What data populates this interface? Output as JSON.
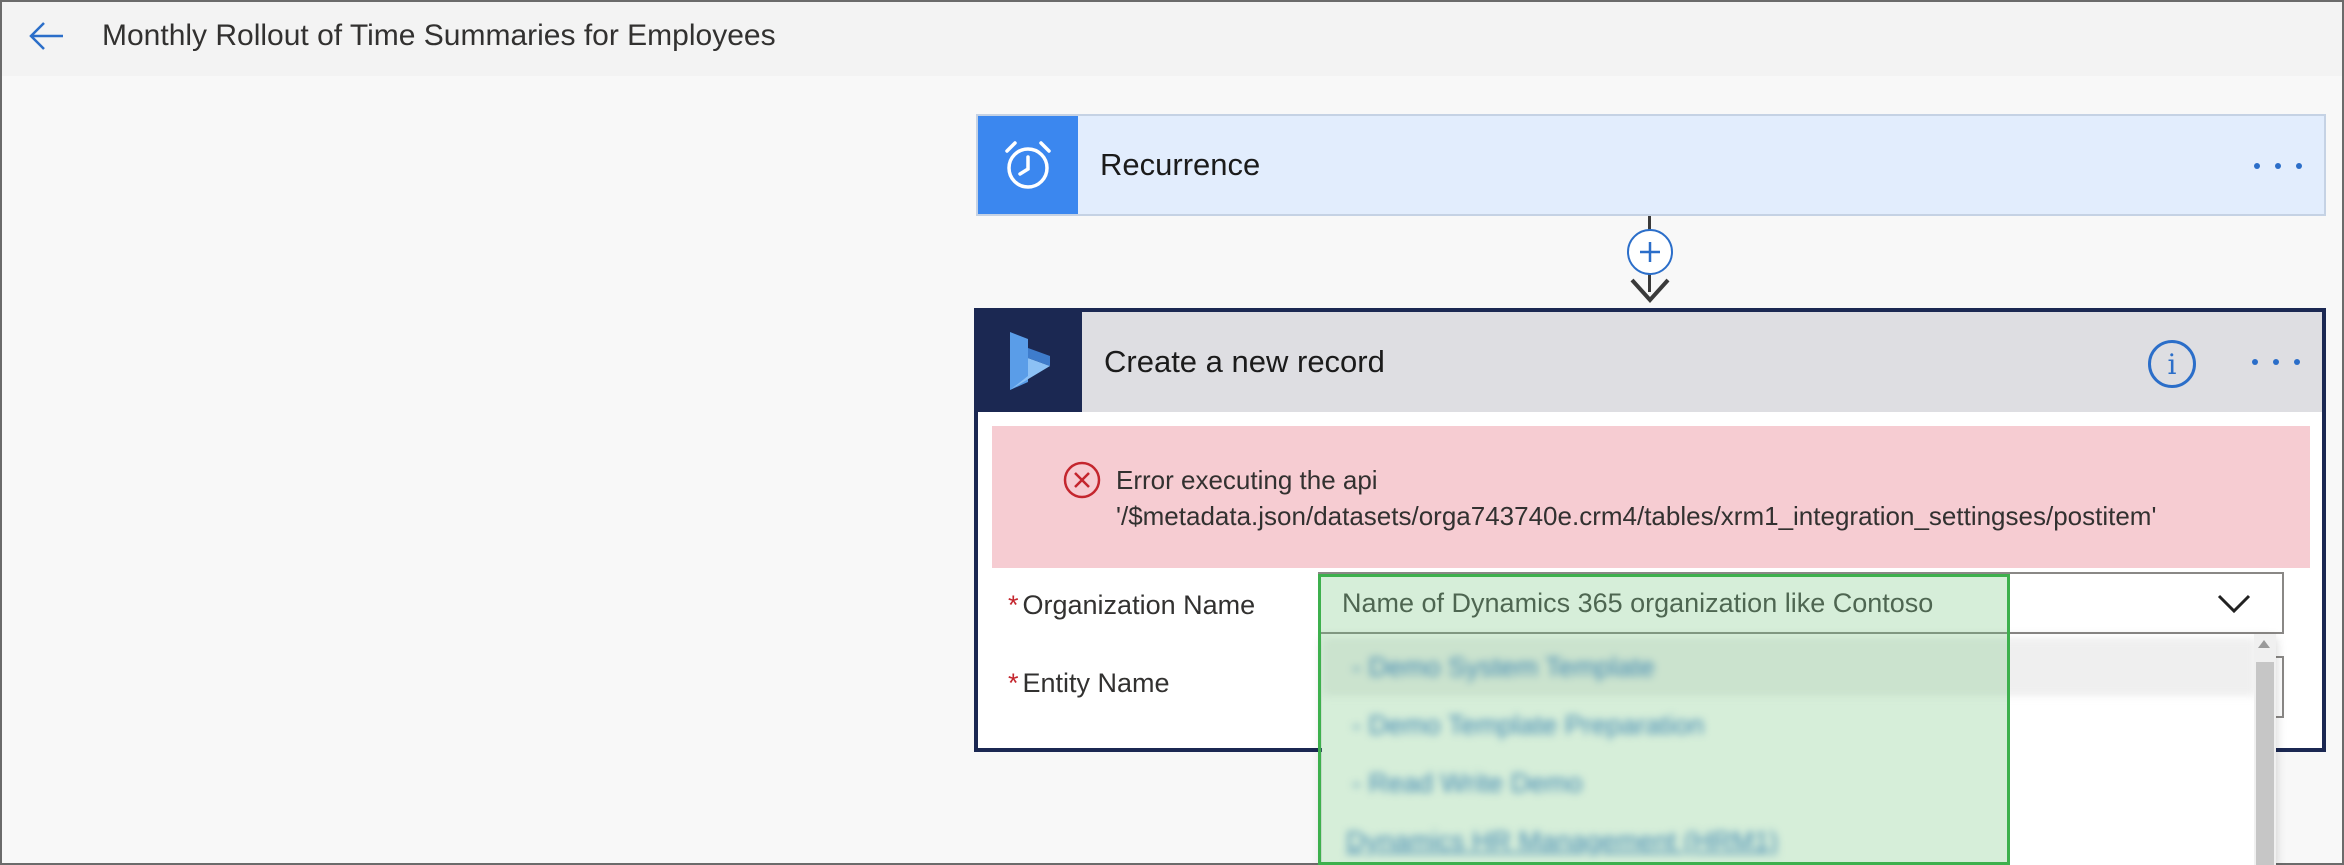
{
  "header": {
    "title": "Monthly Rollout of Time Summaries for Employees"
  },
  "recurrence": {
    "label": "Recurrence"
  },
  "create_record": {
    "label": "Create a new record",
    "info_label": "i",
    "error": {
      "line1": "Error executing the api",
      "line2": "'/$metadata.json/datasets/orga743740e.crm4/tables/xrm1_integration_settingses/postitem'"
    },
    "fields": {
      "organization": {
        "required": "*",
        "label": "Organization Name",
        "placeholder": "Name of Dynamics 365 organization like Contoso"
      },
      "entity": {
        "required": "*",
        "label": "Entity Name"
      }
    }
  },
  "dropdown": {
    "items": [
      "- Demo System Template",
      "- Demo Template Preparation",
      "- Read Write Demo",
      "Dynamics HR Management (HRM1)"
    ]
  },
  "colors": {
    "accent": "#2b6ec9",
    "recurrence_icon_bg": "#3b87ef",
    "dynamics_icon_bg": "#1b2852",
    "error_bg": "#f6ccd2",
    "error_icon": "#c4262e",
    "highlight": "#3db04d"
  },
  "icons": {
    "back": "arrow-left-icon",
    "recurrence": "alarm-clock-icon",
    "dynamics": "dynamics-365-icon",
    "error": "error-circle-icon",
    "info": "info-icon",
    "add": "plus-circle-icon",
    "more": "more-dots-icon",
    "chevron": "chevron-down-icon"
  }
}
